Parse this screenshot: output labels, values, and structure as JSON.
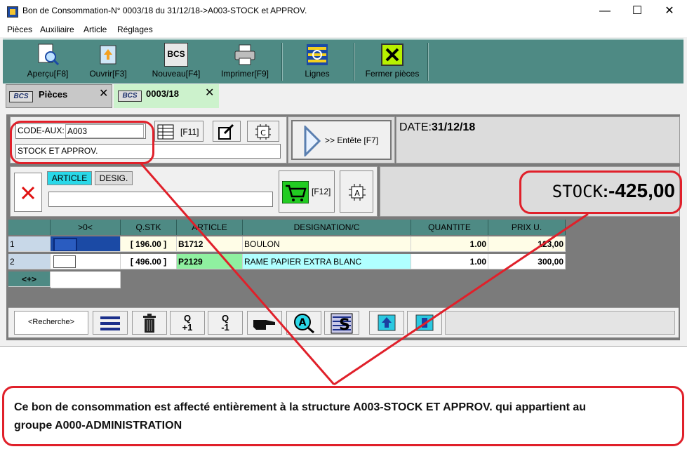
{
  "window": {
    "title": "Bon de Consommation-N° 0003/18 du 31/12/18->A003-STOCK et APPROV.",
    "controls": {
      "minimize": "—",
      "maximize": "☐",
      "close": "✕"
    }
  },
  "menu": [
    "Pièces",
    "Auxiliaire",
    "Article",
    "Réglages"
  ],
  "toolbar": {
    "preview": "Aperçu[F8]",
    "open": "Ouvrir[F3]",
    "new": "Nouveau[F4]",
    "print": "Imprimer[F9]",
    "lines": "Lignes",
    "close_pieces": "Fermer pièces",
    "new_icon_text": "BCS"
  },
  "tabs": {
    "pieces": {
      "label": "Pièces",
      "badge": "BCS",
      "close": "✕"
    },
    "doc": {
      "label": "0003/18",
      "badge": "BCS",
      "close": "✕"
    }
  },
  "header": {
    "code_aux_label": "CODE-AUX:",
    "code_aux_value": "A003",
    "aux_name": "STOCK ET APPROV.",
    "f11": "[F11]",
    "c_icon": "C",
    "entete_btn": ">> Entête [F7]",
    "date_label": "DATE:",
    "date_value": "31/12/18"
  },
  "article_bar": {
    "article_btn": "ARTICLE",
    "desig_btn": "DESIG.",
    "f12": "[F12]",
    "a_icon": "A",
    "stock_label": "STOCK",
    "stock_sep": ":",
    "stock_value": "-425,00"
  },
  "grid": {
    "headers": [
      ">0<",
      "Q.STK",
      "ARTICLE",
      "DESIGNATION/C",
      "QUANTITE",
      "PRIX U."
    ],
    "rows": [
      {
        "num": "1",
        "qstk": "[ 196.00 ]",
        "article": "B1712",
        "designation": "BOULON",
        "quantite": "1.00",
        "prix": "123,00"
      },
      {
        "num": "2",
        "qstk": "[ 496.00 ]",
        "article": "P2129",
        "designation": "RAME PAPIER EXTRA BLANC",
        "quantite": "1.00",
        "prix": "300,00"
      }
    ],
    "add_row": "<+>"
  },
  "bottom": {
    "search": "<Recherche>",
    "q_plus": "Q\n+1",
    "q_minus": "Q\n-1",
    "q_plus_top": "Q",
    "q_plus_bottom": "+1",
    "q_minus_top": "Q",
    "q_minus_bottom": "-1",
    "a_letter": "A",
    "s_letter": "S"
  },
  "callout": {
    "line1": "Ce bon de consommation est affecté entièrement à la structure A003-STOCK ET APPROV. qui appartient au",
    "line2": "groupe A000-ADMINISTRATION"
  },
  "colors": {
    "toolbar": "#4e8a84",
    "annotation": "#e0202a",
    "tab_active": "#ccf2cc",
    "row_selected": "#fffde7",
    "article_highlight": "#8ff0a0",
    "desig_highlight": "#b0ffff"
  }
}
